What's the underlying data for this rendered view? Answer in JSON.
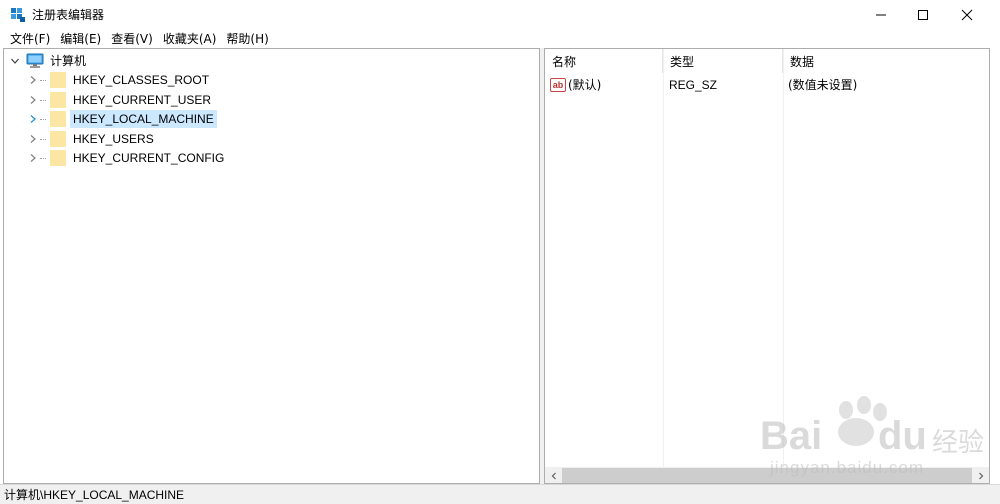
{
  "window": {
    "title": "注册表编辑器",
    "controls": {
      "minimize_icon": "minimize-icon",
      "maximize_icon": "maximize-icon",
      "close_icon": "close-icon"
    }
  },
  "menu": [
    {
      "label": "文件(F)"
    },
    {
      "label": "编辑(E)"
    },
    {
      "label": "查看(V)"
    },
    {
      "label": "收藏夹(A)"
    },
    {
      "label": "帮助(H)"
    }
  ],
  "tree": {
    "root": {
      "label": "计算机",
      "icon": "computer-icon",
      "expanded": true
    },
    "children": [
      {
        "label": "HKEY_CLASSES_ROOT",
        "icon": "folder-icon"
      },
      {
        "label": "HKEY_CURRENT_USER",
        "icon": "folder-icon"
      },
      {
        "label": "HKEY_LOCAL_MACHINE",
        "icon": "folder-icon",
        "selected": true
      },
      {
        "label": "HKEY_USERS",
        "icon": "folder-icon"
      },
      {
        "label": "HKEY_CURRENT_CONFIG",
        "icon": "folder-icon"
      }
    ]
  },
  "list": {
    "columns": [
      "名称",
      "类型",
      "数据"
    ],
    "rows": [
      {
        "name": "(默认)",
        "type": "REG_SZ",
        "data": "(数值未设置)",
        "icon": "string-value-icon"
      }
    ]
  },
  "statusbar": {
    "path_prefix": "计算机",
    "path_rest": "\\HKEY_LOCAL_MACHINE"
  },
  "watermark": {
    "brand": "Bai",
    "brand2": "du",
    "cn": "经验",
    "url": "jingyan.baidu.com"
  },
  "colors": {
    "selection": "#cce8ff",
    "folder": "#f8d775",
    "statusbar": "#f0f0f0",
    "border": "#adadad",
    "app_icon": "#1a78c2"
  }
}
